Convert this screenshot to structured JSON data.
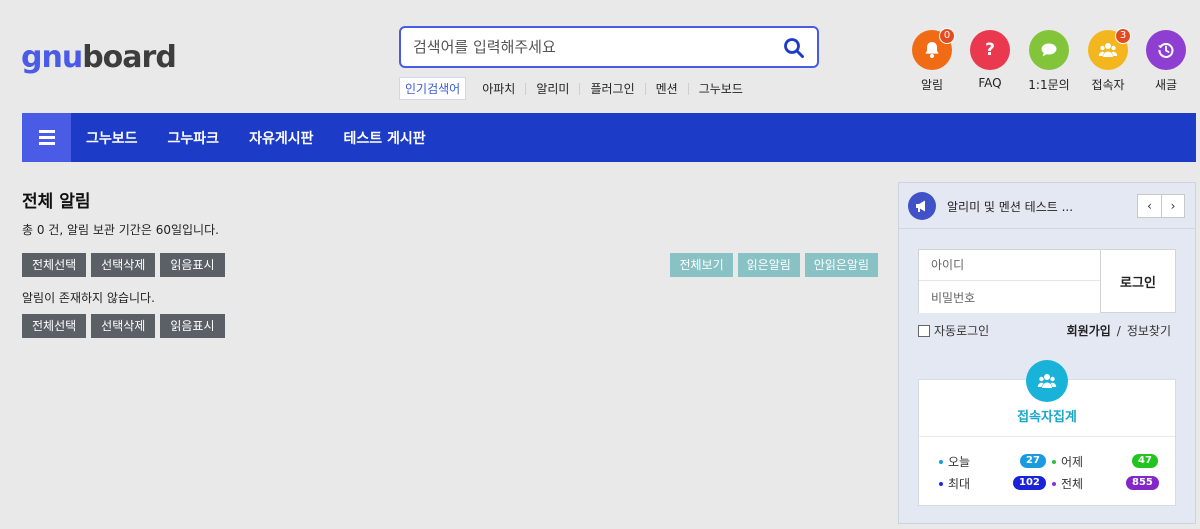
{
  "logo": {
    "part1": "gnu",
    "part2": "board"
  },
  "search": {
    "placeholder": "검색어를 입력해주세요",
    "value": ""
  },
  "popular": {
    "label": "인기검색어",
    "items": [
      "아파치",
      "알리미",
      "플러그인",
      "멘션",
      "그누보드"
    ]
  },
  "quick": [
    {
      "label": "알림",
      "icon": "bell-icon",
      "color": "#f06b14",
      "badge": "0"
    },
    {
      "label": "FAQ",
      "icon": "question-icon",
      "color": "#ea384f",
      "badge": ""
    },
    {
      "label": "1:1문의",
      "icon": "chat-icon",
      "color": "#82c43a",
      "badge": ""
    },
    {
      "label": "접속자",
      "icon": "users-icon",
      "color": "#f3b61f",
      "badge": "3"
    },
    {
      "label": "새글",
      "icon": "history-icon",
      "color": "#8e3ed0",
      "badge": ""
    }
  ],
  "nav": {
    "items": [
      "그누보드",
      "그누파크",
      "자유게시판",
      "테스트 게시판"
    ]
  },
  "main": {
    "title": "전체 알림",
    "summary": "총 0 건, 알림 보관 기간은 60일입니다.",
    "buttons": {
      "select_all": "전체선택",
      "delete_selected": "선택삭제",
      "mark_read": "읽음표시"
    },
    "filters": {
      "all": "전체보기",
      "read": "읽은알림",
      "unread": "안읽은알림"
    },
    "empty": "알림이 존재하지 않습니다."
  },
  "side": {
    "notice": "알리미 및 멘션 테스트 ...",
    "login": {
      "id_placeholder": "아이디",
      "pw_placeholder": "비밀번호",
      "button": "로그인",
      "auto": "자동로그인",
      "join": "회원가입",
      "sep": "/",
      "find": "정보찾기"
    },
    "visitors": {
      "title": "접속자집계",
      "today_label": "오늘",
      "today": "27",
      "yesterday_label": "어제",
      "yesterday": "47",
      "max_label": "최대",
      "max": "102",
      "total_label": "전체",
      "total": "855"
    }
  },
  "colors": {
    "brand": "#4a5be5",
    "nav_bg": "#1c3bc6",
    "teal_btn": "#88c2c4",
    "dark_btn": "#5a6066"
  }
}
